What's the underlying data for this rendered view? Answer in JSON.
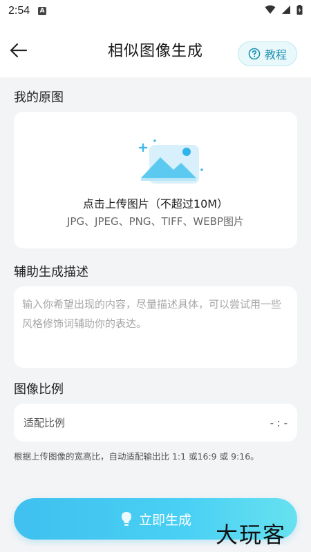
{
  "status_bar": {
    "time": "2:54",
    "notification_badge": "A"
  },
  "header": {
    "title": "相似图像生成",
    "tutorial_label": "教程"
  },
  "original_section": {
    "title": "我的原图",
    "upload_main": "点击上传图片（不超过10M）",
    "upload_sub": "JPG、JPEG、PNG、TIFF、WEBP图片"
  },
  "description_section": {
    "title": "辅助生成描述",
    "placeholder": "输入你希望出现的内容，尽量描述具体，可以尝试用一些风格修饰词辅助你的表达。",
    "value": ""
  },
  "ratio_section": {
    "title": "图像比例",
    "label": "适配比例",
    "value": "- : -",
    "hint": "根据上传图像的宽高比，自动适配输出比 1:1 或16:9 或 9:16。"
  },
  "generate_button": {
    "label": "立即生成"
  },
  "watermark": "大玩客",
  "colors": {
    "accent": "#3fc0ef",
    "tutorial_text": "#1b8fb0",
    "background": "#f3f4f6"
  }
}
